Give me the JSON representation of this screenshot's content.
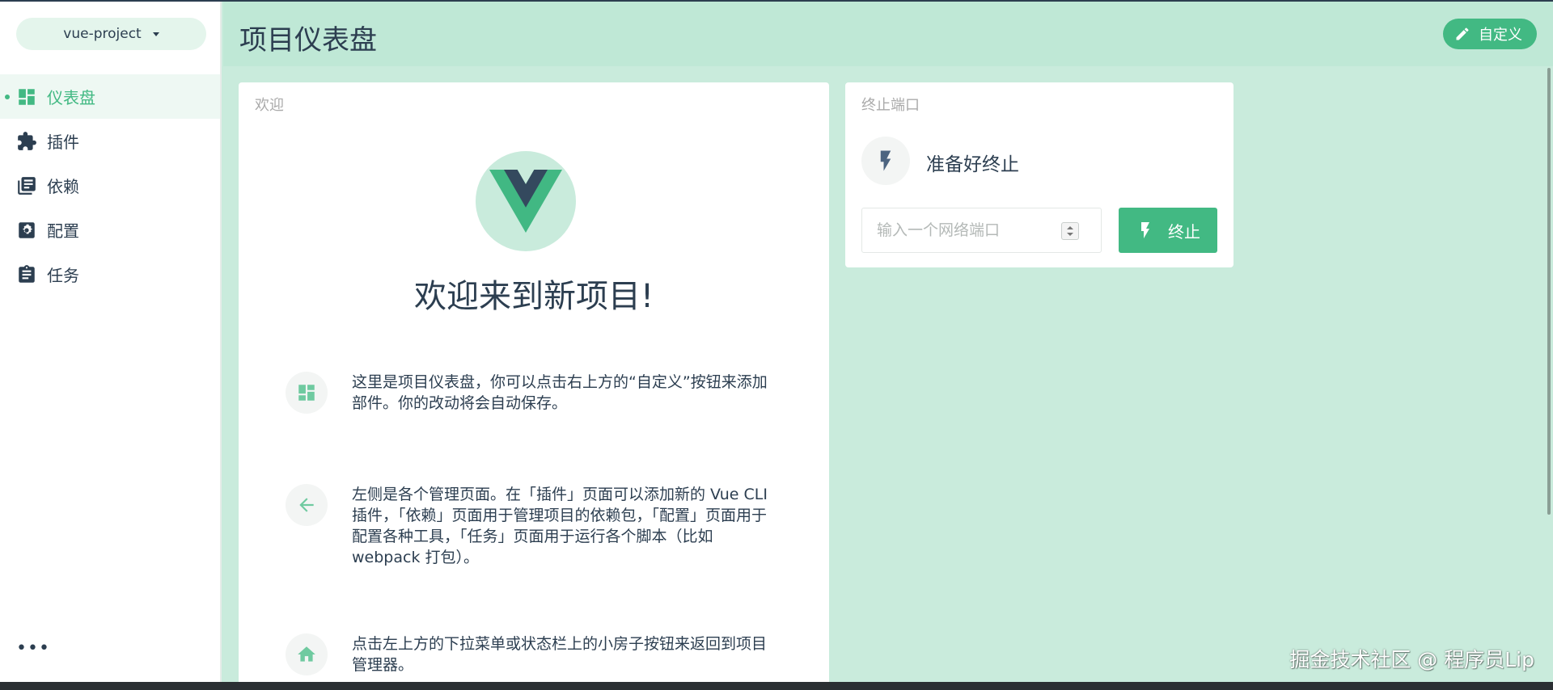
{
  "sidebar": {
    "project_name": "vue-project",
    "items": [
      {
        "label": "仪表盘",
        "icon": "dashboard-icon",
        "active": true
      },
      {
        "label": "插件",
        "icon": "puzzle-icon"
      },
      {
        "label": "依赖",
        "icon": "library-books-icon"
      },
      {
        "label": "配置",
        "icon": "settings-box-icon"
      },
      {
        "label": "任务",
        "icon": "clipboard-icon"
      }
    ],
    "more": "•••"
  },
  "header": {
    "title": "项目仪表盘",
    "customize_label": "自定义"
  },
  "welcome_widget": {
    "title": "欢迎",
    "heading": "欢迎来到新项目!",
    "tips": [
      {
        "icon": "dashboard-icon",
        "text": "这里是项目仪表盘，你可以点击右上方的“自定义”按钮来添加部件。你的改动将会自动保存。"
      },
      {
        "icon": "arrow-left-icon",
        "text": "左侧是各个管理页面。在「插件」页面可以添加新的 Vue CLI 插件，「依赖」页面用于管理项目的依赖包，「配置」页面用于配置各种工具，「任务」页面用于运行各个脚本（比如 webpack 打包）。"
      },
      {
        "icon": "home-icon",
        "text": "点击左上方的下拉菜单或状态栏上的小房子按钮来返回到项目管理器。"
      }
    ]
  },
  "kill_port_widget": {
    "title": "终止端口",
    "status": "准备好终止",
    "port_placeholder": "输入一个网络端口",
    "kill_label": "终止"
  },
  "watermark": "掘金技术社区 @ 程序员Lip",
  "colors": {
    "accent": "#42b983",
    "text": "#2c3e50",
    "header_bg": "#bfe8d6",
    "content_bg": "#c9ebdc"
  }
}
